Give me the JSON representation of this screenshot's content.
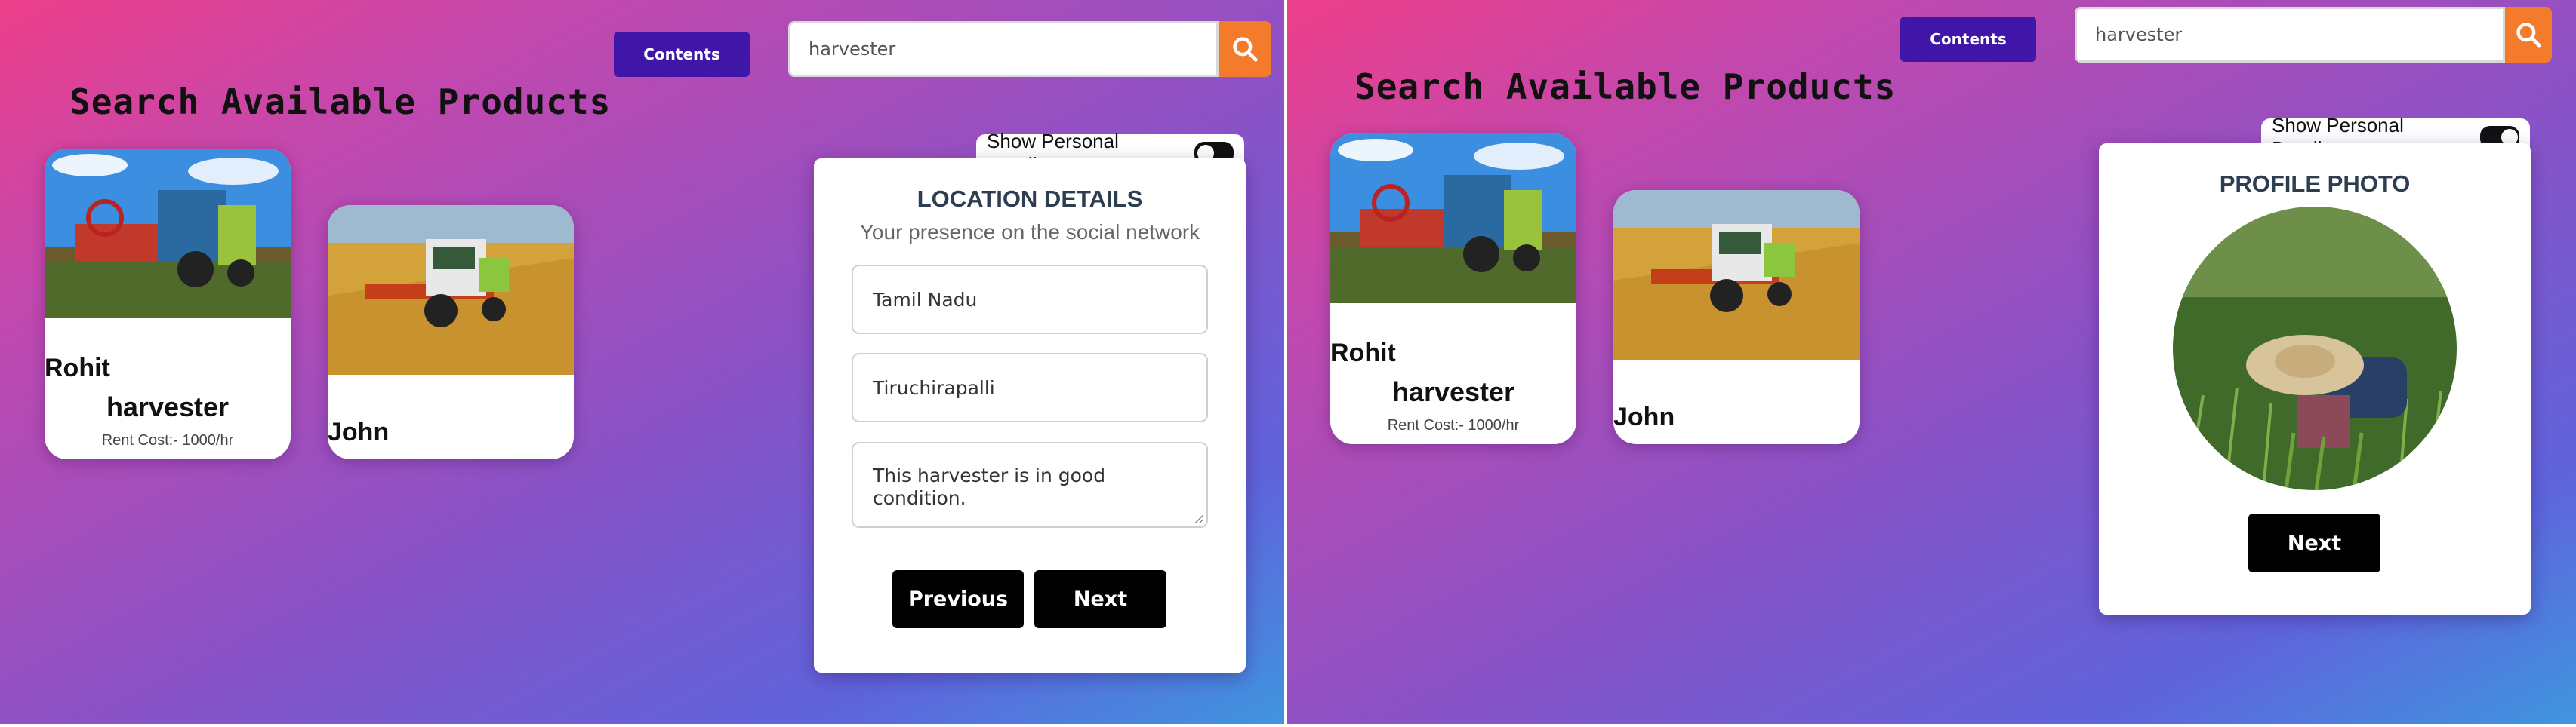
{
  "screens": [
    {
      "contents_label": "Contents",
      "search": {
        "value": "harvester",
        "icon": "search-icon"
      },
      "heading": "Search Available Products",
      "products": [
        {
          "owner": "Rohit",
          "name": "harvester",
          "rent": "Rent Cost:- 1000/hr"
        },
        {
          "owner": "John"
        }
      ],
      "toggle": {
        "label": "Show Personal Details :",
        "on": false
      },
      "form": {
        "title": "LOCATION DETAILS",
        "subtitle": "Your presence on the social network",
        "state": "Tamil Nadu",
        "city": "Tiruchirapalli",
        "description": "This harvester is in good condition.",
        "previous_label": "Previous",
        "next_label": "Next"
      }
    },
    {
      "contents_label": "Contents",
      "search": {
        "value": "harvester",
        "icon": "search-icon"
      },
      "heading": "Search Available Products",
      "products": [
        {
          "owner": "Rohit",
          "name": "harvester",
          "rent": "Rent Cost:- 1000/hr"
        },
        {
          "owner": "John"
        }
      ],
      "toggle": {
        "label": "Show Personal Details :",
        "on": true
      },
      "form": {
        "title": "PROFILE PHOTO",
        "next_label": "Next"
      }
    }
  ],
  "colors": {
    "contents_button": "#3f16a8",
    "search_button": "#f47a2c",
    "primary_button": "#000000",
    "gradient_start": "#ee3f8a",
    "gradient_end": "#3f95df"
  }
}
